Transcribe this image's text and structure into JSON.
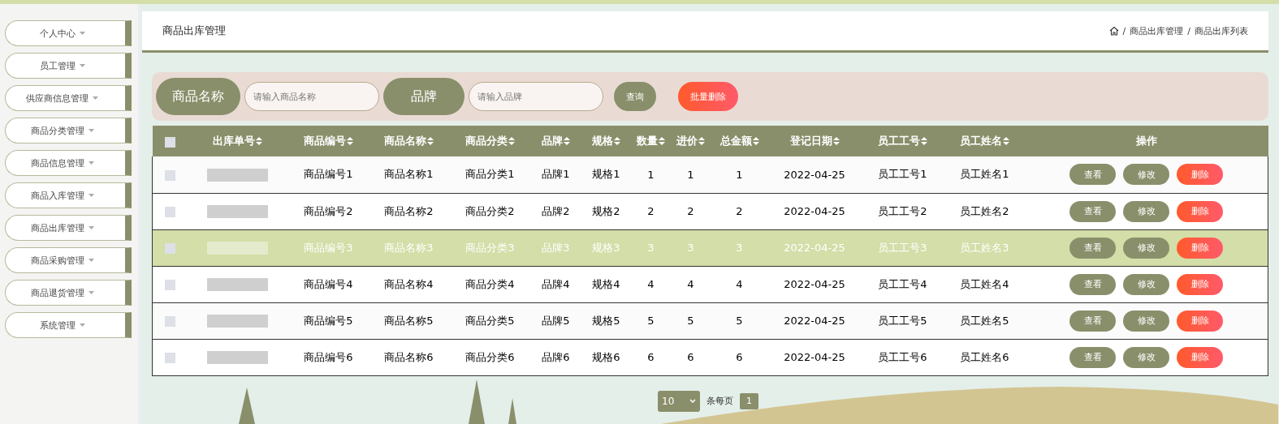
{
  "sidebar": {
    "items": [
      {
        "label": "个人中心"
      },
      {
        "label": "员工管理"
      },
      {
        "label": "供应商信息管理"
      },
      {
        "label": "商品分类管理"
      },
      {
        "label": "商品信息管理"
      },
      {
        "label": "商品入库管理"
      },
      {
        "label": "商品出库管理"
      },
      {
        "label": "商品采购管理"
      },
      {
        "label": "商品退货管理"
      },
      {
        "label": "系统管理"
      }
    ]
  },
  "header": {
    "title": "商品出库管理",
    "separator": "/",
    "breadcrumb": [
      "商品出库管理",
      "商品出库列表"
    ]
  },
  "search": {
    "fields": [
      {
        "label": "商品名称",
        "placeholder": "请输入商品名称"
      },
      {
        "label": "品牌",
        "placeholder": "请输入品牌"
      }
    ],
    "buttons": [
      {
        "kind": "query",
        "label": "查询"
      },
      {
        "kind": "danger",
        "label": "批量删除"
      }
    ]
  },
  "table": {
    "select_all": {
      "checked": false
    },
    "columns": [
      {
        "kind": "redacted",
        "label": "出库单号"
      },
      {
        "kind": "text",
        "label": "商品编号"
      },
      {
        "kind": "text",
        "label": "商品名称"
      },
      {
        "kind": "text",
        "label": "商品分类"
      },
      {
        "kind": "text",
        "label": "品牌"
      },
      {
        "kind": "text",
        "label": "规格"
      },
      {
        "kind": "text",
        "label": "数量"
      },
      {
        "kind": "text",
        "label": "进价"
      },
      {
        "kind": "text",
        "label": "总金额"
      },
      {
        "kind": "text",
        "label": "登记日期"
      },
      {
        "kind": "text",
        "label": "员工工号"
      },
      {
        "kind": "text",
        "label": "员工姓名"
      },
      {
        "kind": "actions",
        "label": "操作"
      }
    ],
    "rows": [
      {
        "checked": false,
        "hovered": false,
        "cells": [
          "",
          "商品编号1",
          "商品名称1",
          "商品分类1",
          "品牌1",
          "规格1",
          "1",
          "1",
          "1",
          "2022-04-25",
          "员工工号1",
          "员工姓名1"
        ],
        "actions": [
          {
            "kind": "view",
            "label": "查看"
          },
          {
            "kind": "edit",
            "label": "修改"
          },
          {
            "kind": "delete",
            "label": "删除"
          }
        ]
      },
      {
        "checked": false,
        "hovered": false,
        "cells": [
          "",
          "商品编号2",
          "商品名称2",
          "商品分类2",
          "品牌2",
          "规格2",
          "2",
          "2",
          "2",
          "2022-04-25",
          "员工工号2",
          "员工姓名2"
        ],
        "actions": [
          {
            "kind": "view",
            "label": "查看"
          },
          {
            "kind": "edit",
            "label": "修改"
          },
          {
            "kind": "delete",
            "label": "删除"
          }
        ]
      },
      {
        "checked": false,
        "hovered": true,
        "cells": [
          "",
          "商品编号3",
          "商品名称3",
          "商品分类3",
          "品牌3",
          "规格3",
          "3",
          "3",
          "3",
          "2022-04-25",
          "员工工号3",
          "员工姓名3"
        ],
        "actions": [
          {
            "kind": "view",
            "label": "查看"
          },
          {
            "kind": "edit",
            "label": "修改"
          },
          {
            "kind": "delete",
            "label": "删除"
          }
        ]
      },
      {
        "checked": false,
        "hovered": false,
        "cells": [
          "",
          "商品编号4",
          "商品名称4",
          "商品分类4",
          "品牌4",
          "规格4",
          "4",
          "4",
          "4",
          "2022-04-25",
          "员工工号4",
          "员工姓名4"
        ],
        "actions": [
          {
            "kind": "view",
            "label": "查看"
          },
          {
            "kind": "edit",
            "label": "修改"
          },
          {
            "kind": "delete",
            "label": "删除"
          }
        ]
      },
      {
        "checked": false,
        "hovered": false,
        "cells": [
          "",
          "商品编号5",
          "商品名称5",
          "商品分类5",
          "品牌5",
          "规格5",
          "5",
          "5",
          "5",
          "2022-04-25",
          "员工工号5",
          "员工姓名5"
        ],
        "actions": [
          {
            "kind": "view",
            "label": "查看"
          },
          {
            "kind": "edit",
            "label": "修改"
          },
          {
            "kind": "delete",
            "label": "删除"
          }
        ]
      },
      {
        "checked": false,
        "hovered": false,
        "cells": [
          "",
          "商品编号6",
          "商品名称6",
          "商品分类6",
          "品牌6",
          "规格6",
          "6",
          "6",
          "6",
          "2022-04-25",
          "员工工号6",
          "员工姓名6"
        ],
        "actions": [
          {
            "kind": "view",
            "label": "查看"
          },
          {
            "kind": "edit",
            "label": "修改"
          },
          {
            "kind": "delete",
            "label": "删除"
          }
        ]
      }
    ]
  },
  "pagination": {
    "page_size": "10",
    "page_size_label": "条每页",
    "pages": [
      {
        "label": "1",
        "selected": true
      }
    ]
  }
}
